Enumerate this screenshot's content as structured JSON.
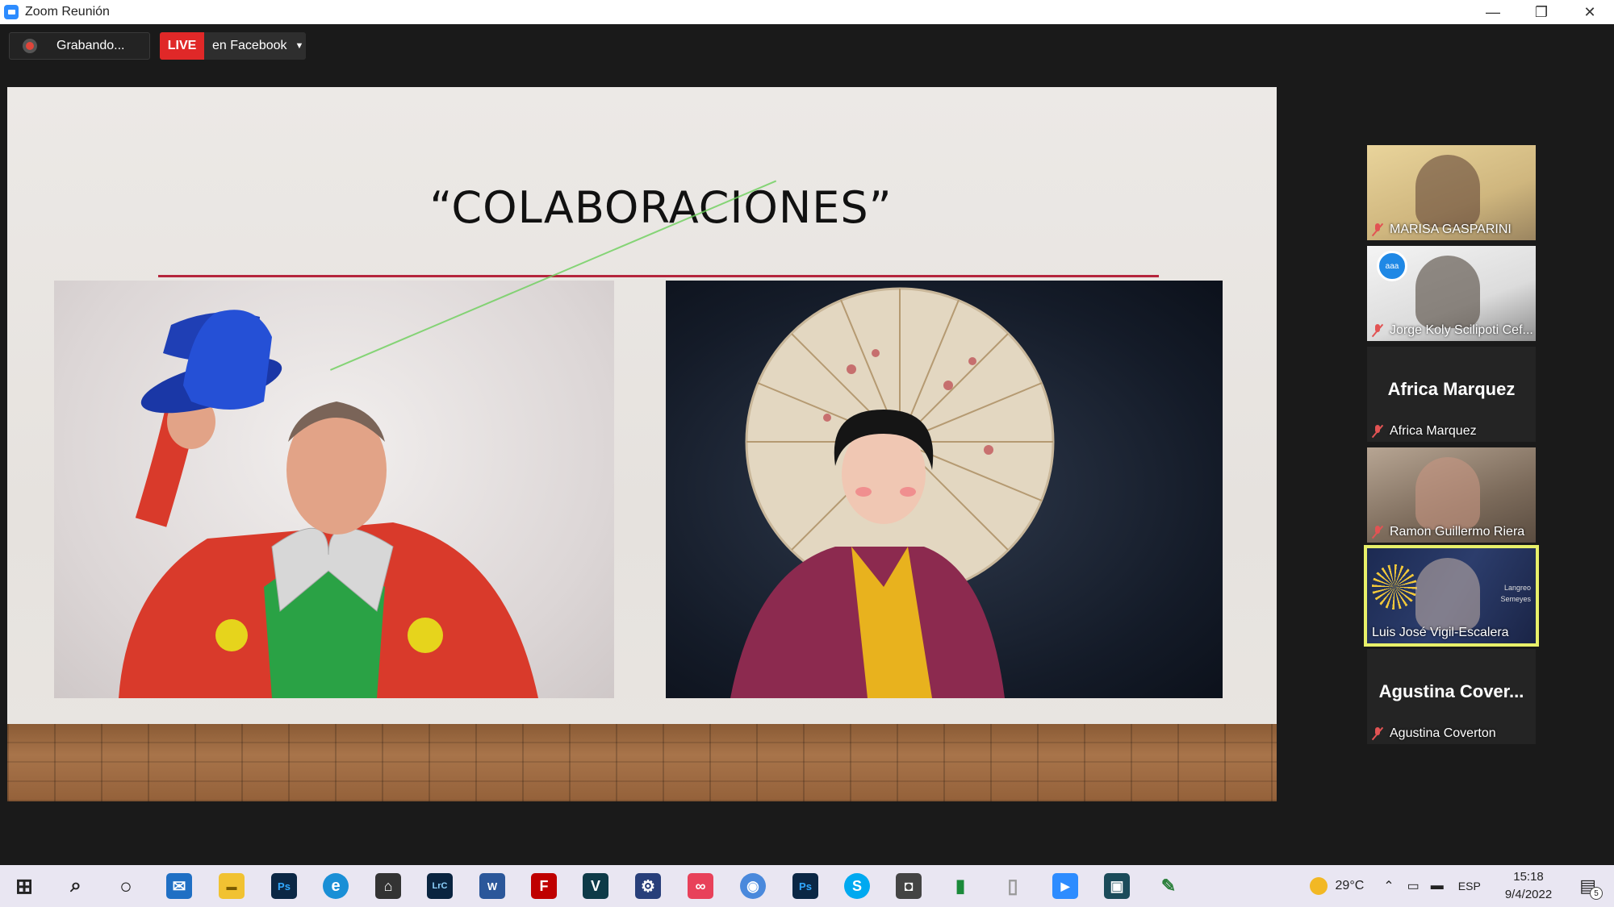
{
  "window": {
    "title": "Zoom Reunión",
    "controls": {
      "minimize": "—",
      "restore": "❐",
      "close": "✕"
    }
  },
  "recording": {
    "label": "Grabando..."
  },
  "live": {
    "badge": "LIVE",
    "destination": "en Facebook"
  },
  "slide": {
    "title": "“COLABORACIONES”"
  },
  "participants": [
    {
      "name": "MARISA GASPARINI",
      "muted": true,
      "video": true
    },
    {
      "name": "Jorge Koly Scilipoti Cef...",
      "muted": true,
      "video": true
    },
    {
      "name": "Africa Marquez",
      "display_name": "Africa Marquez",
      "muted": true,
      "video": false
    },
    {
      "name": "Ramon Guillermo Riera",
      "muted": true,
      "video": true
    },
    {
      "name": "Luis José Vigil-Escalera",
      "muted": false,
      "video": true,
      "active_speaker": true,
      "overlay_text": [
        "Langreo",
        "Semeyes"
      ]
    },
    {
      "name": "Agustina Coverton",
      "display_name": "Agustina  Cover...",
      "muted": true,
      "video": false
    }
  ],
  "taskbar": {
    "apps": [
      {
        "name": "start",
        "glyph": "⊞"
      },
      {
        "name": "search",
        "glyph": "⌕"
      },
      {
        "name": "cortana",
        "glyph": "○"
      },
      {
        "name": "mail",
        "glyph": "✉"
      },
      {
        "name": "file-explorer",
        "glyph": "▬"
      },
      {
        "name": "photoshop",
        "glyph": "Ps"
      },
      {
        "name": "edge",
        "glyph": "e"
      },
      {
        "name": "store",
        "glyph": "⌂"
      },
      {
        "name": "lightroom-classic",
        "glyph": "LrC"
      },
      {
        "name": "word",
        "glyph": "W"
      },
      {
        "name": "filezilla",
        "glyph": "F"
      },
      {
        "name": "vegas",
        "glyph": "V"
      },
      {
        "name": "settings",
        "glyph": "⚙"
      },
      {
        "name": "creative-cloud",
        "glyph": "∞"
      },
      {
        "name": "chrome",
        "glyph": "◉"
      },
      {
        "name": "photoshop-2",
        "glyph": "Ps"
      },
      {
        "name": "skype",
        "glyph": "S"
      },
      {
        "name": "camera",
        "glyph": "◘"
      },
      {
        "name": "charts-app",
        "glyph": "▮"
      },
      {
        "name": "notepad",
        "glyph": "▯"
      },
      {
        "name": "zoom",
        "glyph": "▶"
      },
      {
        "name": "screen-app",
        "glyph": "▣"
      },
      {
        "name": "paint-app",
        "glyph": "✎"
      }
    ],
    "weather": "29°C",
    "language": "ESP",
    "time": "15:18",
    "date": "9/4/2022",
    "notifications": "5"
  },
  "colors": {
    "live_red": "#e02828",
    "active_speaker_border": "#e8f06a",
    "slide_accent_line": "#b5253c",
    "muted_icon": "#e25353"
  }
}
